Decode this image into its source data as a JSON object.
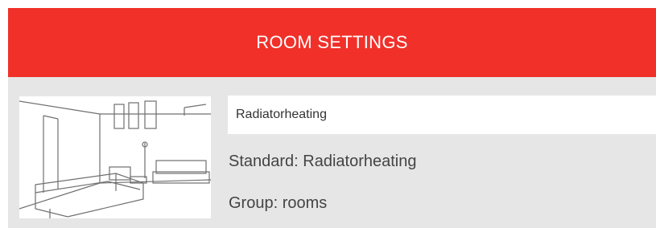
{
  "header": {
    "title": "ROOM SETTINGS",
    "color": "#f1302a"
  },
  "room": {
    "image_icon": "room-sketch-image",
    "name_value": "Radiatorheating",
    "standard_text": "Standard: Radiatorheating",
    "group_text": "Group: rooms"
  },
  "colors": {
    "panel_background": "#e6e6e6",
    "text": "#444444"
  }
}
